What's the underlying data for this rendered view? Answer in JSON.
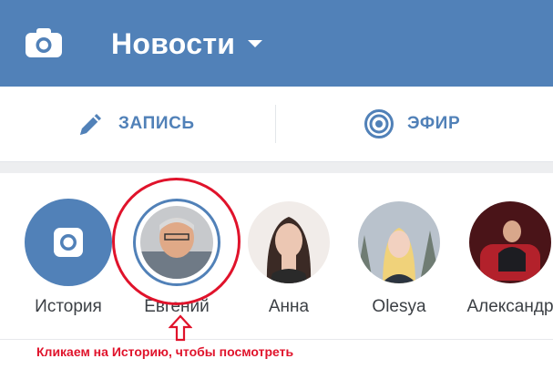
{
  "header": {
    "title": "Новости"
  },
  "actions": {
    "post_label": "ЗАПИСЬ",
    "live_label": "ЭФИР"
  },
  "stories": [
    {
      "name": "История",
      "kind": "add"
    },
    {
      "name": "Евгений"
    },
    {
      "name": "Анна"
    },
    {
      "name": "Olesya"
    },
    {
      "name": "Александр"
    }
  ],
  "annotation": {
    "caption": "Кликаем на Историю, чтобы посмотреть"
  },
  "colors": {
    "brand": "#5181b8",
    "annotation": "#e0132b"
  },
  "icons": {
    "camera": "camera-icon",
    "menu": "chevron-down-icon",
    "post": "pencil-icon",
    "live": "live-broadcast-icon"
  }
}
